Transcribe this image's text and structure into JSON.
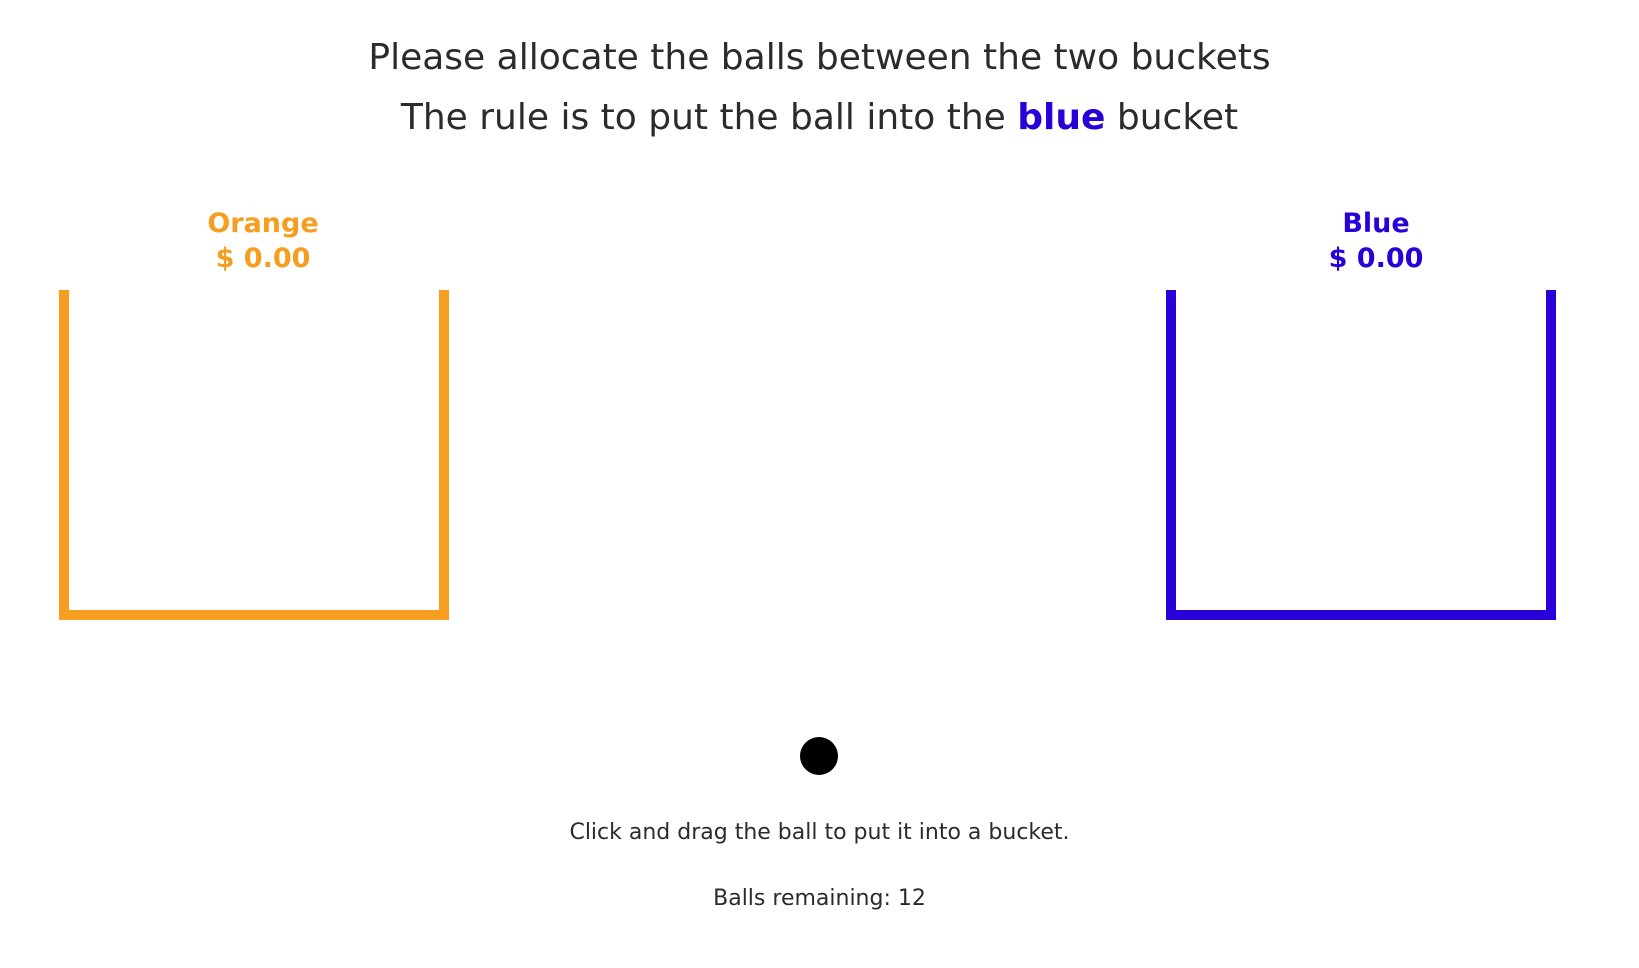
{
  "header": {
    "line1": "Please allocate the balls between the two buckets",
    "line2_prefix": "The rule is to put the ball into the ",
    "line2_emphasis": "blue",
    "line2_suffix": " bucket"
  },
  "buckets": [
    {
      "label": "Orange",
      "amount": "$ 0.00",
      "color": "#f59e1f"
    },
    {
      "label": "Blue",
      "amount": "$ 0.00",
      "color": "#2a00d8"
    }
  ],
  "ball": {
    "color": "#000000"
  },
  "instruction": "Click and drag the ball to put it into a bucket.",
  "remaining": "Balls remaining: 12"
}
